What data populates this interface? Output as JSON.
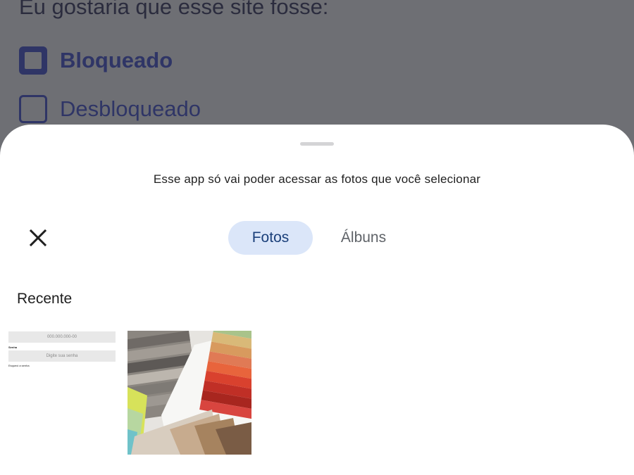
{
  "background": {
    "title": "Eu gostaria que esse site fosse:",
    "options": [
      {
        "label": "Bloqueado",
        "checked": true
      },
      {
        "label": "Desbloqueado",
        "checked": false
      }
    ]
  },
  "sheet": {
    "subtitle": "Esse app só vai poder acessar as fotos que você selecionar",
    "close_icon": "close-icon",
    "tabs": [
      {
        "label": "Fotos",
        "selected": true
      },
      {
        "label": "Álbuns",
        "selected": false
      }
    ],
    "section_title": "Recente",
    "thumbnails": [
      {
        "kind": "screenshot",
        "field1": "000.000.000-00",
        "label1": "Senha",
        "field2": "Digite sua senha",
        "label2": "Esqueci a senha"
      },
      {
        "kind": "photo"
      }
    ]
  },
  "colors": {
    "accent_tab_bg": "#dbe6f9",
    "accent_tab_text": "#1a3f7a",
    "scrim": "#6e6f74"
  }
}
